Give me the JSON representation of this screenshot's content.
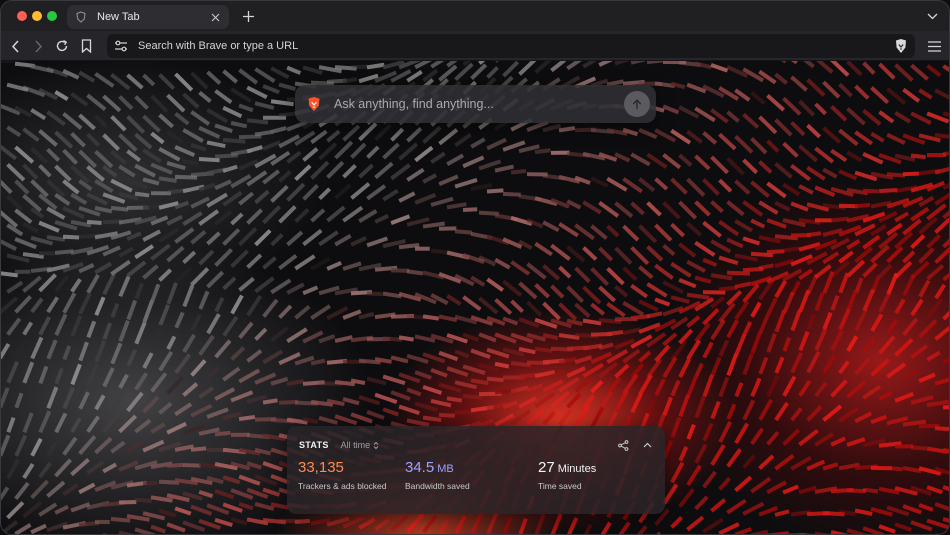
{
  "tab": {
    "title": "New Tab",
    "favicon": "brave-shield-icon",
    "close_icon": "close-icon"
  },
  "tabstrip": {
    "new_tab_icon": "plus-icon",
    "tab_list_icon": "chevron-down-icon"
  },
  "toolbar": {
    "back_icon": "chevron-left-icon",
    "forward_icon": "chevron-right-icon",
    "reload_icon": "reload-icon",
    "bookmark_icon": "bookmark-icon",
    "site_settings_icon": "sliders-icon",
    "url_placeholder": "Search with Brave or type a URL",
    "shields_icon": "brave-lion-icon",
    "menu_icon": "hamburger-icon"
  },
  "search": {
    "placeholder": "Ask anything, find anything...",
    "logo_icon": "brave-lion-icon",
    "submit_icon": "arrow-up-icon"
  },
  "stats": {
    "title": "STATS",
    "range": "All time",
    "share_icon": "share-icon",
    "collapse_icon": "chevron-up-icon",
    "trackers": {
      "value": "33,135",
      "label": "Trackers & ads blocked"
    },
    "bandwidth": {
      "value": "34.5",
      "unit": "MB",
      "label": "Bandwidth saved"
    },
    "time": {
      "value": "27",
      "unit": "Minutes",
      "label": "Time saved"
    }
  },
  "colors": {
    "trackers_accent": "#ff8a50",
    "bandwidth_accent": "#a0a0ff",
    "brave_orange": "#fb542b"
  }
}
